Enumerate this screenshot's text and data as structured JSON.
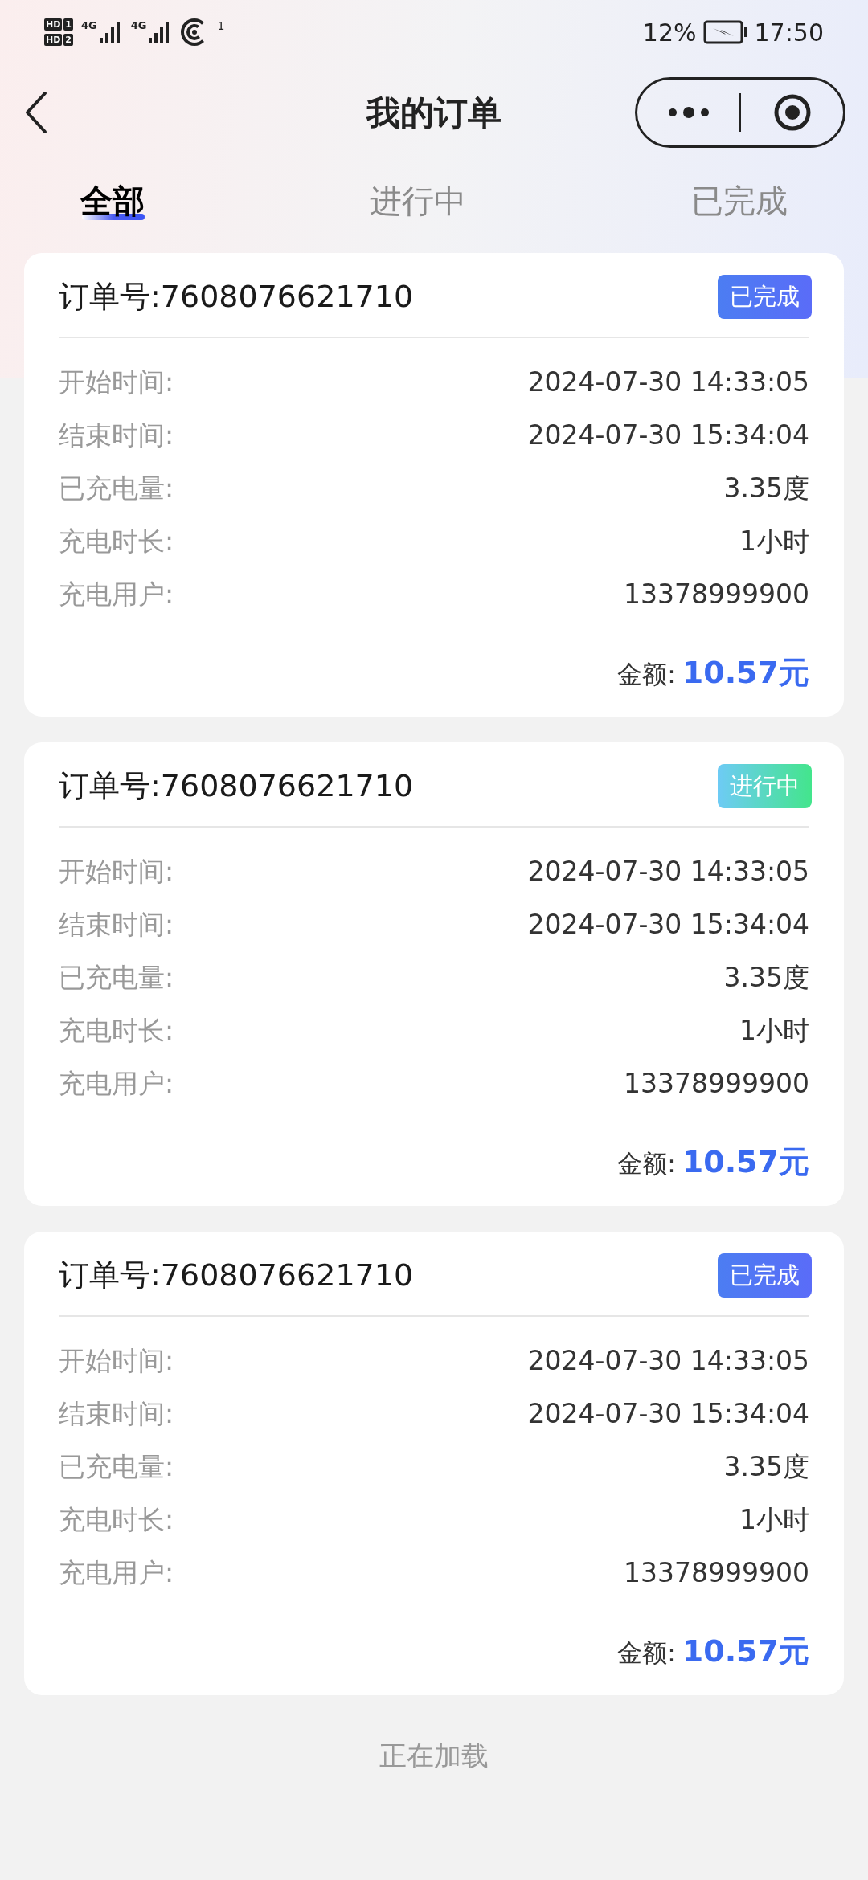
{
  "status_bar": {
    "sims": [
      {
        "label": "HD",
        "slot": "1",
        "network": "4G"
      },
      {
        "label": "HD",
        "slot": "2",
        "network": "4G"
      }
    ],
    "hotspot_count": "1",
    "battery": "12%",
    "time": "17:50"
  },
  "header": {
    "title": "我的订单"
  },
  "tabs": [
    {
      "label": "全部",
      "selected": true
    },
    {
      "label": "进行中",
      "selected": false
    },
    {
      "label": "已完成",
      "selected": false
    }
  ],
  "orders": [
    {
      "order_no": "订单号:7608076621710",
      "status": {
        "label": "已完成",
        "kind": "done"
      },
      "fields": [
        {
          "label": "开始时间:",
          "value": "2024-07-30 14:33:05"
        },
        {
          "label": "结束时间:",
          "value": "2024-07-30 15:34:04"
        },
        {
          "label": "已充电量:",
          "value": "3.35度"
        },
        {
          "label": "充电时长:",
          "value": "1小时"
        },
        {
          "label": "充电用户:",
          "value": "13378999900"
        }
      ],
      "amount_label": "金额:",
      "amount": "10.57元"
    },
    {
      "order_no": "订单号:7608076621710",
      "status": {
        "label": "进行中",
        "kind": "ongoing"
      },
      "fields": [
        {
          "label": "开始时间:",
          "value": "2024-07-30 14:33:05"
        },
        {
          "label": "结束时间:",
          "value": "2024-07-30 15:34:04"
        },
        {
          "label": "已充电量:",
          "value": "3.35度"
        },
        {
          "label": "充电时长:",
          "value": "1小时"
        },
        {
          "label": "充电用户:",
          "value": "13378999900"
        }
      ],
      "amount_label": "金额:",
      "amount": "10.57元"
    },
    {
      "order_no": "订单号:7608076621710",
      "status": {
        "label": "已完成",
        "kind": "done"
      },
      "fields": [
        {
          "label": "开始时间:",
          "value": "2024-07-30 14:33:05"
        },
        {
          "label": "结束时间:",
          "value": "2024-07-30 15:34:04"
        },
        {
          "label": "已充电量:",
          "value": "3.35度"
        },
        {
          "label": "充电时长:",
          "value": "1小时"
        },
        {
          "label": "充电用户:",
          "value": "13378999900"
        }
      ],
      "amount_label": "金额:",
      "amount": "10.57元"
    }
  ],
  "loading": "正在加载"
}
